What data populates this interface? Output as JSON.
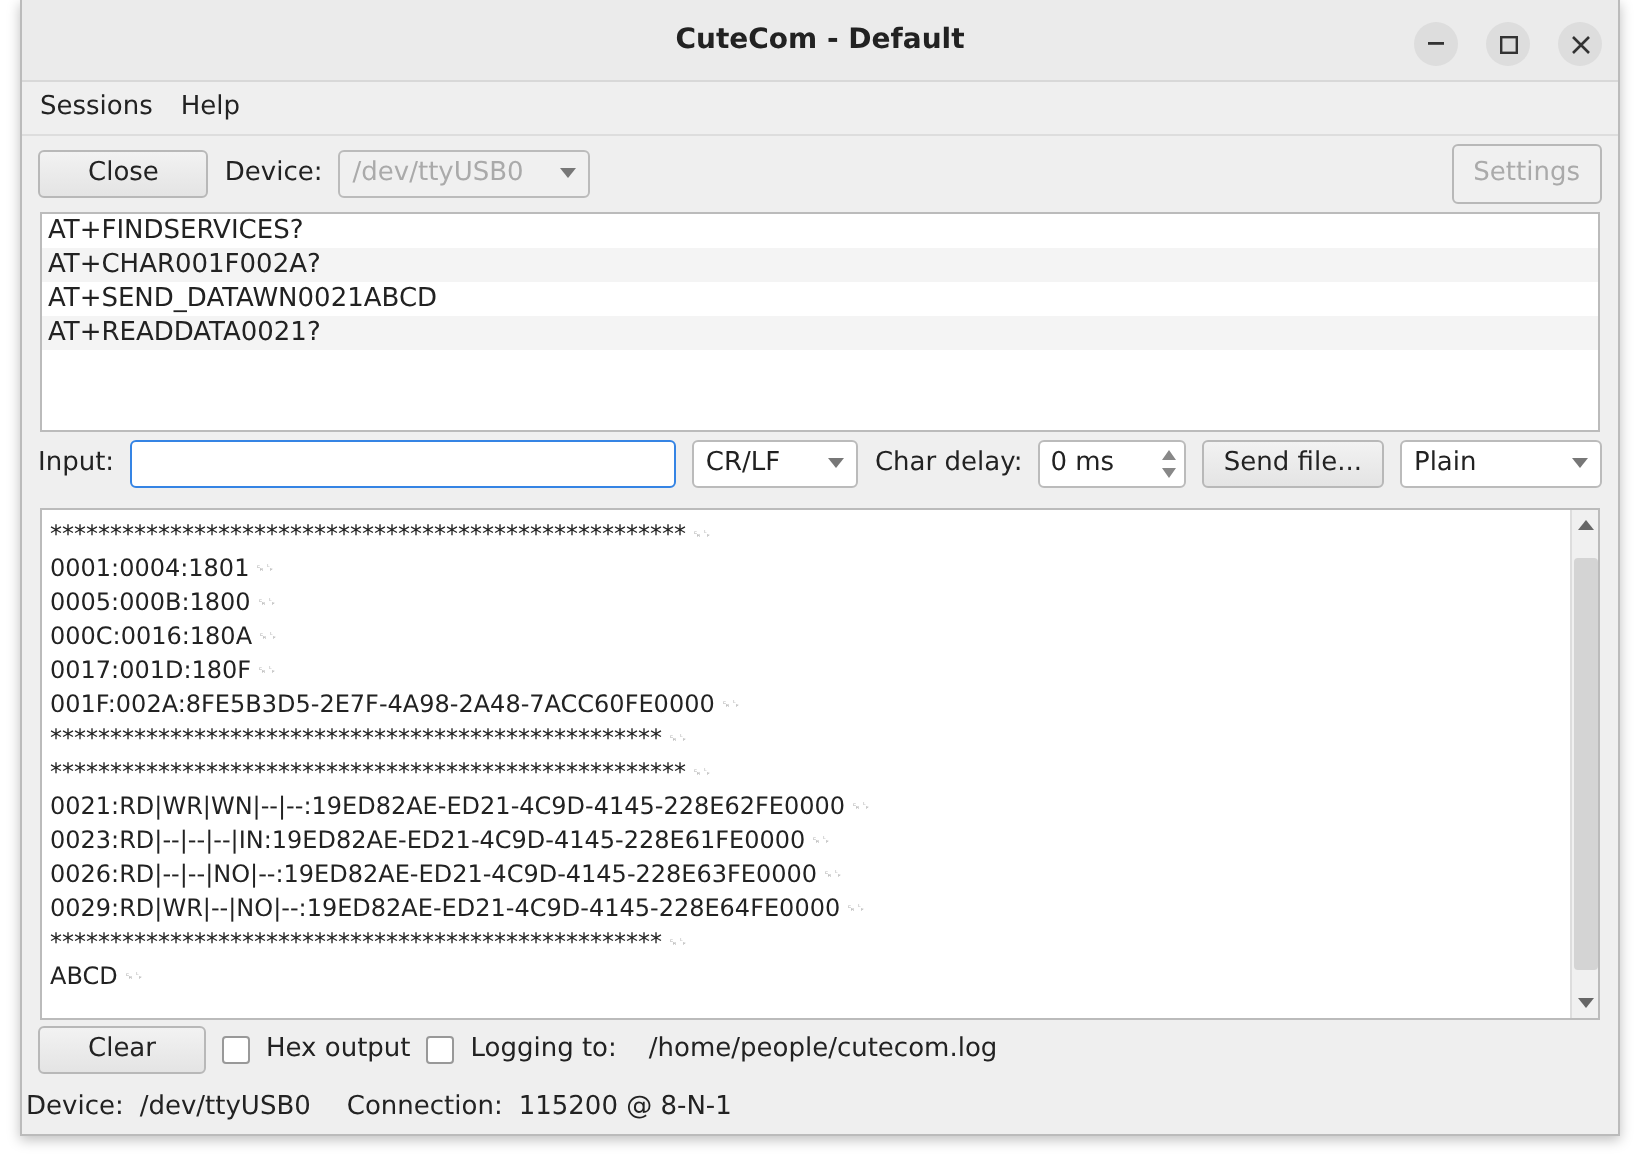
{
  "window": {
    "title": "CuteCom - Default"
  },
  "menu": [
    {
      "label": "Sessions"
    },
    {
      "label": "Help"
    }
  ],
  "toolbar": {
    "close_button": "Close",
    "device_label": "Device:",
    "device_value": "/dev/ttyUSB0",
    "device_disabled": true,
    "settings_button": "Settings",
    "settings_disabled": true
  },
  "command_history": [
    {
      "text": "AT+FINDSERVICES?"
    },
    {
      "text": "AT+CHAR001F002A?"
    },
    {
      "text": "AT+SEND_DATAWN0021ABCD"
    },
    {
      "text": "AT+READDATA0021?"
    }
  ],
  "input_row": {
    "label": "Input:",
    "focused": true,
    "line_end": "CR/LF",
    "char_delay_label": "Char delay:",
    "char_delay": "0 ms",
    "send_file_button": "Send file...",
    "format": "Plain"
  },
  "output": [
    {
      "text": "*****************************************************",
      "eol": "␍␊"
    },
    {
      "text": "0001:0004:1801",
      "eol": "␍␊"
    },
    {
      "text": "0005:000B:1800",
      "eol": "␍␊"
    },
    {
      "text": "000C:0016:180A",
      "eol": "␍␊"
    },
    {
      "text": "0017:001D:180F",
      "eol": "␍␊"
    },
    {
      "text": "001F:002A:8FE5B3D5-2E7F-4A98-2A48-7ACC60FE0000",
      "eol": "␍␊"
    },
    {
      "text": "***************************************************",
      "eol": "␍␊"
    },
    {
      "text": "*****************************************************",
      "eol": "␍␊"
    },
    {
      "text": "0021:RD|WR|WN|--|--:19ED82AE-ED21-4C9D-4145-228E62FE0000",
      "eol": "␍␊"
    },
    {
      "text": "0023:RD|--|--|--|IN:19ED82AE-ED21-4C9D-4145-228E61FE0000",
      "eol": "␍␊"
    },
    {
      "text": "0026:RD|--|--|NO|--:19ED82AE-ED21-4C9D-4145-228E63FE0000",
      "eol": "␍␊"
    },
    {
      "text": "0029:RD|WR|--|NO|--:19ED82AE-ED21-4C9D-4145-228E64FE0000",
      "eol": "␍␊"
    },
    {
      "text": "***************************************************",
      "eol": "␍␊"
    },
    {
      "text": "ABCD",
      "eol": "␍␊"
    }
  ],
  "bottom_row": {
    "clear_button": "Clear",
    "hex_output": {
      "label": "Hex output",
      "checked": false
    },
    "logging": {
      "label": "Logging to:",
      "checked": false
    },
    "log_path": "/home/people/cutecom.log"
  },
  "status_bar": {
    "device_label": "Device:",
    "device": "/dev/ttyUSB0",
    "connection_label": "Connection:",
    "connection": "115200 @ 8-N-1"
  }
}
